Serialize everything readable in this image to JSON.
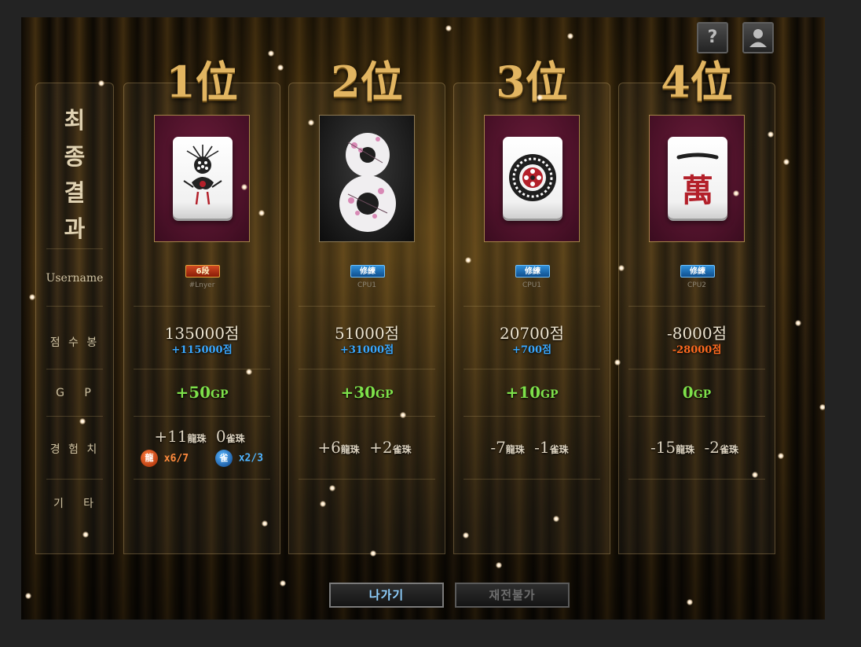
{
  "top_buttons": {
    "help_label": "?",
    "profile_icon": "person-icon"
  },
  "labels": {
    "title_chars": [
      "최",
      "종",
      "결",
      "과"
    ],
    "username": "Username",
    "score": "점 수 봉",
    "gp": "G   P",
    "exp": "경 험 치",
    "etc": "기   타"
  },
  "players": [
    {
      "rank": "1位",
      "tile": "one-of-bamboo-bird",
      "badge": "6段",
      "badge_type": "dan",
      "name": "#Lnyer",
      "score": "135000점",
      "delta": "+115000점",
      "delta_color": "#39a8ff",
      "gp_value": "+50",
      "gp_unit": "GP",
      "exp_dragon": "+11",
      "exp_dragon_unit": "龍珠",
      "exp_sparrow": "0",
      "exp_sparrow_unit": "雀珠",
      "dragon_orb": "龍",
      "dragon_progress": "x6/7",
      "sparrow_orb": "雀",
      "sparrow_progress": "x2/3"
    },
    {
      "rank": "2位",
      "tile": "eight-of-dots-plum",
      "badge": "修練",
      "badge_type": "train",
      "name": "CPU1",
      "score": "51000점",
      "delta": "+31000점",
      "delta_color": "#39a8ff",
      "gp_value": "+30",
      "gp_unit": "GP",
      "exp_dragon": "+6",
      "exp_dragon_unit": "龍珠",
      "exp_sparrow": "+2",
      "exp_sparrow_unit": "雀珠"
    },
    {
      "rank": "3位",
      "tile": "one-of-dots",
      "badge": "修練",
      "badge_type": "train",
      "name": "CPU1",
      "score": "20700점",
      "delta": "+700점",
      "delta_color": "#39a8ff",
      "gp_value": "+10",
      "gp_unit": "GP",
      "exp_dragon": "-7",
      "exp_dragon_unit": "龍珠",
      "exp_sparrow": "-1",
      "exp_sparrow_unit": "雀珠"
    },
    {
      "rank": "4位",
      "tile": "one-of-characters",
      "badge": "修練",
      "badge_type": "train",
      "name": "CPU2",
      "score": "-8000점",
      "delta": "-28000점",
      "delta_color": "#ff6a1f",
      "gp_value": "0",
      "gp_unit": "GP",
      "exp_dragon": "-15",
      "exp_dragon_unit": "龍珠",
      "exp_sparrow": "-2",
      "exp_sparrow_unit": "雀珠"
    }
  ],
  "buttons": {
    "exit": "나가기",
    "rematch": "재전불가"
  },
  "colors": {
    "gold": "#e2b561",
    "gp_green": "#7ee04a",
    "plus_blue": "#39a8ff",
    "minus_orange": "#ff6a1f"
  }
}
